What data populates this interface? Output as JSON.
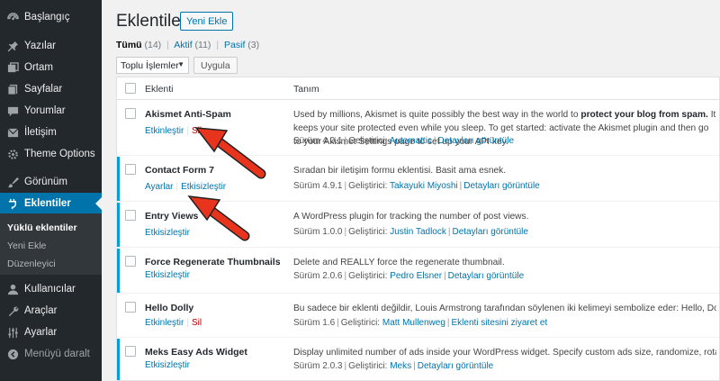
{
  "sidebar": {
    "items": [
      {
        "label": "Başlangıç",
        "icon": "dashboard-icon"
      },
      {
        "label": "Yazılar",
        "icon": "pin-icon"
      },
      {
        "label": "Ortam",
        "icon": "media-icon"
      },
      {
        "label": "Sayfalar",
        "icon": "pages-icon"
      },
      {
        "label": "Yorumlar",
        "icon": "comment-icon"
      },
      {
        "label": "İletişim",
        "icon": "mail-icon"
      },
      {
        "label": "Theme Options",
        "icon": "gear-icon"
      },
      {
        "label": "Görünüm",
        "icon": "brush-icon"
      },
      {
        "label": "Eklentiler",
        "icon": "plugin-icon"
      },
      {
        "label": "Kullanıcılar",
        "icon": "user-icon"
      },
      {
        "label": "Araçlar",
        "icon": "wrench-icon"
      },
      {
        "label": "Ayarlar",
        "icon": "settings-icon"
      },
      {
        "label": "Menüyü daralt",
        "icon": "collapse-icon"
      }
    ],
    "submenu": [
      "Yüklü eklentiler",
      "Yeni Ekle",
      "Düzenleyici"
    ]
  },
  "page": {
    "title": "Eklentiler",
    "add_new": "Yeni Ekle",
    "views": {
      "all_label": "Tümü",
      "all_count": "(14)",
      "active_label": "Aktif",
      "active_count": "(11)",
      "inactive_label": "Pasif",
      "inactive_count": "(3)"
    },
    "bulk_select": "Toplu İşlemler",
    "apply": "Uygula"
  },
  "table": {
    "col_plugin": "Eklenti",
    "col_desc": "Tanım",
    "version_prefix": "Sürüm",
    "author_prefix": "Geliştirici:",
    "details_label": "Detayları görüntüle",
    "rows": [
      {
        "name": "Akismet Anti-Spam",
        "action1": "Etkinleştir",
        "action2": "Sil",
        "desc_a": "Used by millions, Akismet is quite possibly the best way in the world to ",
        "desc_b": "protect your blog from spam.",
        "desc_c": " It keeps your site protected even while you sleep. To get started: activate the Akismet plugin and then go to your Akismet Settings page to set up your API key.",
        "version": "4.0.1",
        "author": "Automattic"
      },
      {
        "name": "Contact Form 7",
        "action1": "Ayarlar",
        "action2": "Etkisizleştir",
        "desc": "Sıradan bir iletişim formu eklentisi. Basit ama esnek.",
        "version": "4.9.1",
        "author": "Takayuki Miyoshi"
      },
      {
        "name": "Entry Views",
        "action1": "Etkisizleştir",
        "desc": "A WordPress plugin for tracking the number of post views.",
        "version": "1.0.0",
        "author": "Justin Tadlock"
      },
      {
        "name": "Force Regenerate Thumbnails",
        "action1": "Etkisizleştir",
        "desc": "Delete and REALLY force the regenerate thumbnail.",
        "version": "2.0.6",
        "author": "Pedro Elsner"
      },
      {
        "name": "Hello Dolly",
        "action1": "Etkinleştir",
        "action2": "Sil",
        "desc": "Bu sadece bir eklenti değildir, Louis Armstrong tarafından söylenen iki kelimeyi sembolize eder: Hello, Dolly. Bu eklenti etkinleştirildiğinde yönetim panelinin sağ üst köşesinde rastgele bir söz görürsünüz.",
        "version": "1.6",
        "author": "Matt Mullenweg",
        "extra_link": "Eklenti sitesini ziyaret et"
      },
      {
        "name": "Meks Easy Ads Widget",
        "action1": "Etkisizleştir",
        "desc": "Display unlimited number of ads inside your WordPress widget. Specify custom ads size, randomize, rotate, enjoy!",
        "version": "2.0.3",
        "author": "Meks"
      }
    ]
  },
  "colors": {
    "accent": "#0073aa",
    "sidebar": "#23282d",
    "arrow": "#e8341c",
    "delete": "#a00"
  }
}
